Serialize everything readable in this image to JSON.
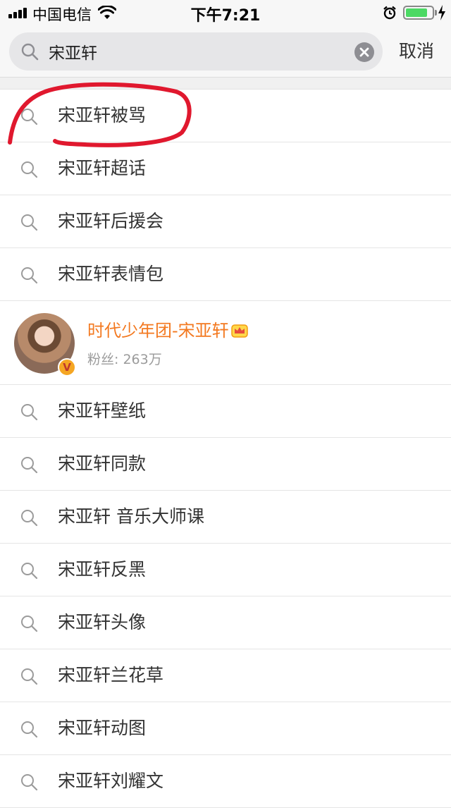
{
  "status_bar": {
    "carrier": "中国电信",
    "time": "下午7:21",
    "battery_level": 0.75
  },
  "search": {
    "query": "宋亚轩",
    "cancel_label": "取消"
  },
  "suggestions_top": [
    {
      "label": "宋亚轩被骂"
    },
    {
      "label": "宋亚轩超话"
    },
    {
      "label": "宋亚轩后援会"
    },
    {
      "label": "宋亚轩表情包"
    }
  ],
  "user_result": {
    "name": "时代少年团-宋亚轩",
    "fans": "粉丝: 263万",
    "verified_badge": "V"
  },
  "suggestions_bottom": [
    {
      "label": "宋亚轩壁纸"
    },
    {
      "label": "宋亚轩同款"
    },
    {
      "label": "宋亚轩 音乐大师课"
    },
    {
      "label": "宋亚轩反黑"
    },
    {
      "label": "宋亚轩头像"
    },
    {
      "label": "宋亚轩兰花草"
    },
    {
      "label": "宋亚轩动图"
    },
    {
      "label": "宋亚轩刘耀文"
    }
  ],
  "colors": {
    "accent_orange": "#f37920",
    "annotation_red": "#e0182e"
  }
}
